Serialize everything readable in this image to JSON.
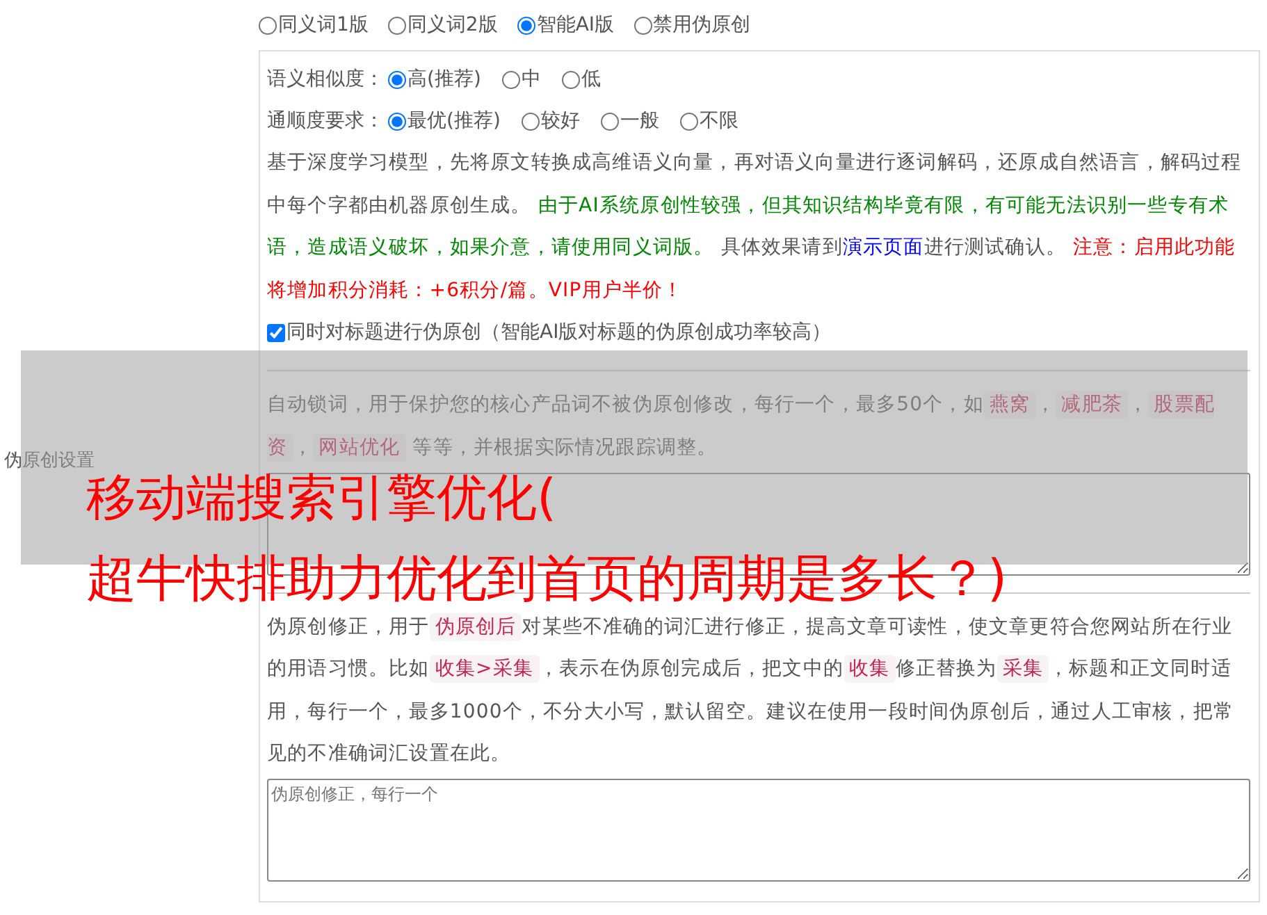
{
  "section_label": "伪原创设置",
  "modes": [
    {
      "label": "同义词1版",
      "selected": false
    },
    {
      "label": "同义词2版",
      "selected": false
    },
    {
      "label": "智能AI版",
      "selected": true
    },
    {
      "label": "禁用伪原创",
      "selected": false
    }
  ],
  "similarity": {
    "label": "语义相似度：",
    "options": [
      {
        "label": "高(推荐)",
        "selected": true
      },
      {
        "label": "中",
        "selected": false
      },
      {
        "label": "低",
        "selected": false
      }
    ]
  },
  "fluency": {
    "label": "通顺度要求：",
    "options": [
      {
        "label": "最优(推荐)",
        "selected": true
      },
      {
        "label": "较好",
        "selected": false
      },
      {
        "label": "一般",
        "selected": false
      },
      {
        "label": "不限",
        "selected": false
      }
    ]
  },
  "ai_description": [
    {
      "kind": "plain",
      "text": "基于深度学习模型，先将原文转换成高维语义向量，再对语义向量进行逐词解码，还原成自然语言，解码过程中每个字都由机器原创生成。 "
    },
    {
      "kind": "green",
      "text": "由于AI系统原创性较强，但其知识结构毕竟有限，有可能无法识别一些专有术语，造成语义破坏，如果介意，请使用同义词版。"
    },
    {
      "kind": "plain",
      "text": " 具体效果请到"
    },
    {
      "kind": "link",
      "text": "演示页面"
    },
    {
      "kind": "plain",
      "text": "进行测试确认。 "
    },
    {
      "kind": "red",
      "text": "注意：启用此功能将增加积分消耗：+6积分/篇。VIP用户半价！"
    }
  ],
  "title_option": {
    "label": "同时对标题进行伪原创（智能AI版对标题的伪原创成功率较高）",
    "checked": true
  },
  "lock_words": {
    "description": [
      {
        "kind": "plain",
        "text": "自动锁词，用于保护您的核心产品词不被伪原创修改，每行一个，最多50个，如"
      },
      {
        "kind": "code",
        "text": "燕窝"
      },
      {
        "kind": "plain",
        "text": "，"
      },
      {
        "kind": "code",
        "text": "减肥茶"
      },
      {
        "kind": "plain",
        "text": "，"
      },
      {
        "kind": "code",
        "text": "股票配资"
      },
      {
        "kind": "plain",
        "text": "，"
      },
      {
        "kind": "code",
        "text": "网站优化"
      },
      {
        "kind": "plain",
        "text": " 等等，并根据实际情况跟踪调整。"
      }
    ]
  },
  "corrections": {
    "description": [
      {
        "kind": "plain",
        "text": "伪原创修正，用于"
      },
      {
        "kind": "code",
        "text": "伪原创后"
      },
      {
        "kind": "plain",
        "text": "对某些不准确的词汇进行修正，提高文章可读性，使文章更符合您网站所在行业的用语习惯。比如"
      },
      {
        "kind": "code",
        "text": "收集>采集"
      },
      {
        "kind": "plain",
        "text": "，表示在伪原创完成后，把文中的"
      },
      {
        "kind": "code",
        "text": "收集"
      },
      {
        "kind": "plain",
        "text": "修正替换为"
      },
      {
        "kind": "code",
        "text": "采集"
      },
      {
        "kind": "plain",
        "text": "，标题和正文同时适用，每行一个，最多1000个，不分大小写，默认留空。建议在使用一段时间伪原创后，通过人工审核，把常见的不准确词汇设置在此。"
      }
    ],
    "placeholder": "伪原创修正，每行一个"
  },
  "overlay_title": [
    "移动端搜索引擎优化(",
    "超牛快排助力优化到首页的周期是多长？)"
  ]
}
